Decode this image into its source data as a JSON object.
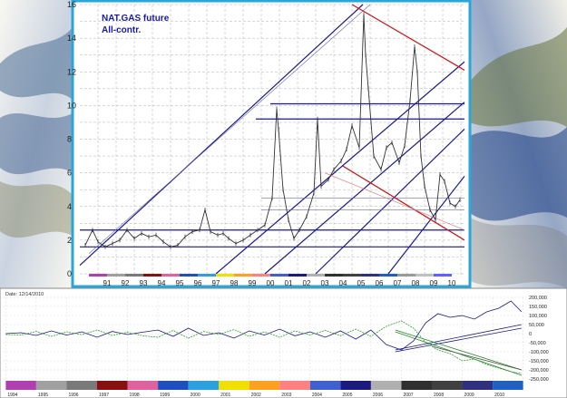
{
  "chart_data": [
    {
      "type": "line",
      "title": "NAT.GAS future",
      "subtitle": "All-contr.",
      "ylim": [
        0,
        16
      ],
      "y_ticks": [
        "0",
        "2",
        "4",
        "6",
        "8",
        "10",
        "12",
        "14",
        "16"
      ],
      "x_ticks": [
        "91",
        "92",
        "93",
        "94",
        "95",
        "96",
        "97",
        "98",
        "99",
        "00",
        "01",
        "02",
        "03",
        "04",
        "05",
        "06",
        "07",
        "08",
        "09",
        "10"
      ],
      "grid": true,
      "series": [
        {
          "x": [
            1990.3,
            1990.7,
            1991.0,
            1991.4,
            1991.8,
            1992.2,
            1992.6,
            1993.0,
            1993.4,
            1993.8,
            1994.2,
            1994.6,
            1995.0,
            1995.4,
            1995.8,
            1996.2,
            1996.6,
            1996.9,
            1997.2,
            1997.6,
            1997.9,
            1998.2,
            1998.6,
            1999.0,
            1999.4,
            1999.8,
            2000.2,
            2000.6,
            2000.85,
            2000.95,
            2001.2,
            2001.5,
            2001.8,
            2002.1,
            2002.5,
            2002.9,
            2003.1,
            2003.3,
            2003.7,
            2004.0,
            2004.4,
            2004.7,
            2005.0,
            2005.4,
            2005.65,
            2005.75,
            2005.9,
            2006.2,
            2006.6,
            2006.9,
            2007.2,
            2007.6,
            2007.9,
            2008.2,
            2008.45,
            2008.6,
            2008.8,
            2009.0,
            2009.3,
            2009.6,
            2009.85,
            2010.1,
            2010.4,
            2010.7,
            2010.95
          ],
          "y": [
            1.7,
            2.6,
            1.9,
            1.6,
            1.8,
            2.0,
            2.6,
            2.1,
            2.4,
            2.2,
            2.3,
            1.9,
            1.6,
            1.7,
            2.2,
            2.5,
            2.6,
            3.8,
            2.5,
            2.3,
            2.4,
            2.1,
            1.8,
            2.0,
            2.3,
            2.6,
            2.9,
            4.5,
            9.8,
            8.6,
            5.0,
            3.2,
            2.1,
            2.6,
            3.4,
            4.8,
            9.2,
            5.2,
            5.6,
            6.2,
            6.7,
            7.4,
            8.8,
            7.5,
            15.4,
            13.0,
            11.0,
            7.0,
            6.2,
            7.5,
            7.8,
            6.6,
            7.6,
            10.3,
            13.5,
            12.0,
            7.0,
            5.2,
            3.8,
            3.2,
            5.9,
            5.5,
            4.2,
            4.0,
            4.4
          ]
        }
      ]
    },
    {
      "type": "line",
      "title": "Date: 12/14/2010",
      "ylim": [
        -250000,
        200000
      ],
      "y_ticks": [
        "200,000",
        "150,000",
        "100,000",
        "50,000",
        "0",
        "-50,000",
        "-100,000",
        "-150,000",
        "-200,000",
        "-250,000"
      ],
      "x_ticks": [
        "1994",
        "1995",
        "1996",
        "1997",
        "1998",
        "1999",
        "2000",
        "2001",
        "2002",
        "2003",
        "2004",
        "2005",
        "2006",
        "2007",
        "2008",
        "2009",
        "2010"
      ],
      "grid": true,
      "series": [
        {
          "x": [
            1994.0,
            1994.5,
            1995.0,
            1995.5,
            1996.0,
            1996.5,
            1997.0,
            1997.5,
            1998.0,
            1998.5,
            1999.0,
            1999.5,
            2000.0,
            2000.5,
            2001.0,
            2001.5,
            2002.0,
            2002.5,
            2003.0,
            2003.5,
            2004.0,
            2004.5,
            2005.0,
            2005.5,
            2006.0,
            2006.5,
            2007.0,
            2007.4,
            2007.8,
            2008.2,
            2008.6,
            2009.0,
            2009.4,
            2009.8,
            2010.2,
            2010.6,
            2010.95
          ],
          "y": [
            0,
            5000,
            -10000,
            15000,
            -8000,
            10000,
            -20000,
            12000,
            -5000,
            8000,
            20000,
            -15000,
            30000,
            -10000,
            5000,
            -25000,
            15000,
            -8000,
            25000,
            -12000,
            10000,
            -20000,
            15000,
            -30000,
            20000,
            -60000,
            -90000,
            -40000,
            60000,
            110000,
            90000,
            100000,
            80000,
            120000,
            140000,
            180000,
            120000
          ]
        },
        {
          "x": [
            1994.0,
            1994.5,
            1995.0,
            1995.5,
            1996.0,
            1996.5,
            1997.0,
            1997.5,
            1998.0,
            1998.5,
            1999.0,
            1999.5,
            2000.0,
            2000.5,
            2001.0,
            2001.5,
            2002.0,
            2002.5,
            2003.0,
            2003.5,
            2004.0,
            2004.5,
            2005.0,
            2005.5,
            2006.0,
            2006.5,
            2007.0,
            2007.4,
            2007.8,
            2008.2,
            2008.6,
            2009.0,
            2009.4,
            2009.8,
            2010.2,
            2010.6,
            2010.95
          ],
          "y": [
            -5000,
            -8000,
            12000,
            -15000,
            10000,
            -6000,
            20000,
            -10000,
            8000,
            -12000,
            -20000,
            18000,
            -25000,
            12000,
            -5000,
            22000,
            -15000,
            10000,
            -20000,
            15000,
            -8000,
            18000,
            -12000,
            25000,
            -15000,
            40000,
            70000,
            30000,
            -50000,
            -90000,
            -110000,
            -150000,
            -140000,
            -170000,
            -190000,
            -210000,
            -220000
          ]
        }
      ]
    }
  ]
}
